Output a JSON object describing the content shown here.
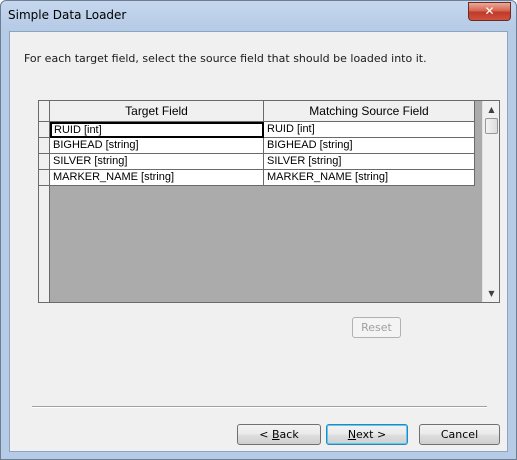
{
  "window": {
    "title": "Simple Data Loader",
    "close_label": "✕"
  },
  "instruction": "For each target field, select the source field that should be loaded into it.",
  "table": {
    "columns": [
      "Target Field",
      "Matching Source Field"
    ],
    "rows": [
      [
        "RUID [int]",
        "RUID [int]"
      ],
      [
        "BIGHEAD [string]",
        "BIGHEAD [string]"
      ],
      [
        "SILVER [string]",
        "SILVER [string]"
      ],
      [
        "MARKER_NAME [string]",
        "MARKER_NAME [string]"
      ]
    ]
  },
  "buttons": {
    "reset": "Reset",
    "back_prefix": "< ",
    "back_key": "B",
    "back_rest": "ack",
    "next_key": "N",
    "next_rest": "ext >",
    "cancel": "Cancel"
  }
}
